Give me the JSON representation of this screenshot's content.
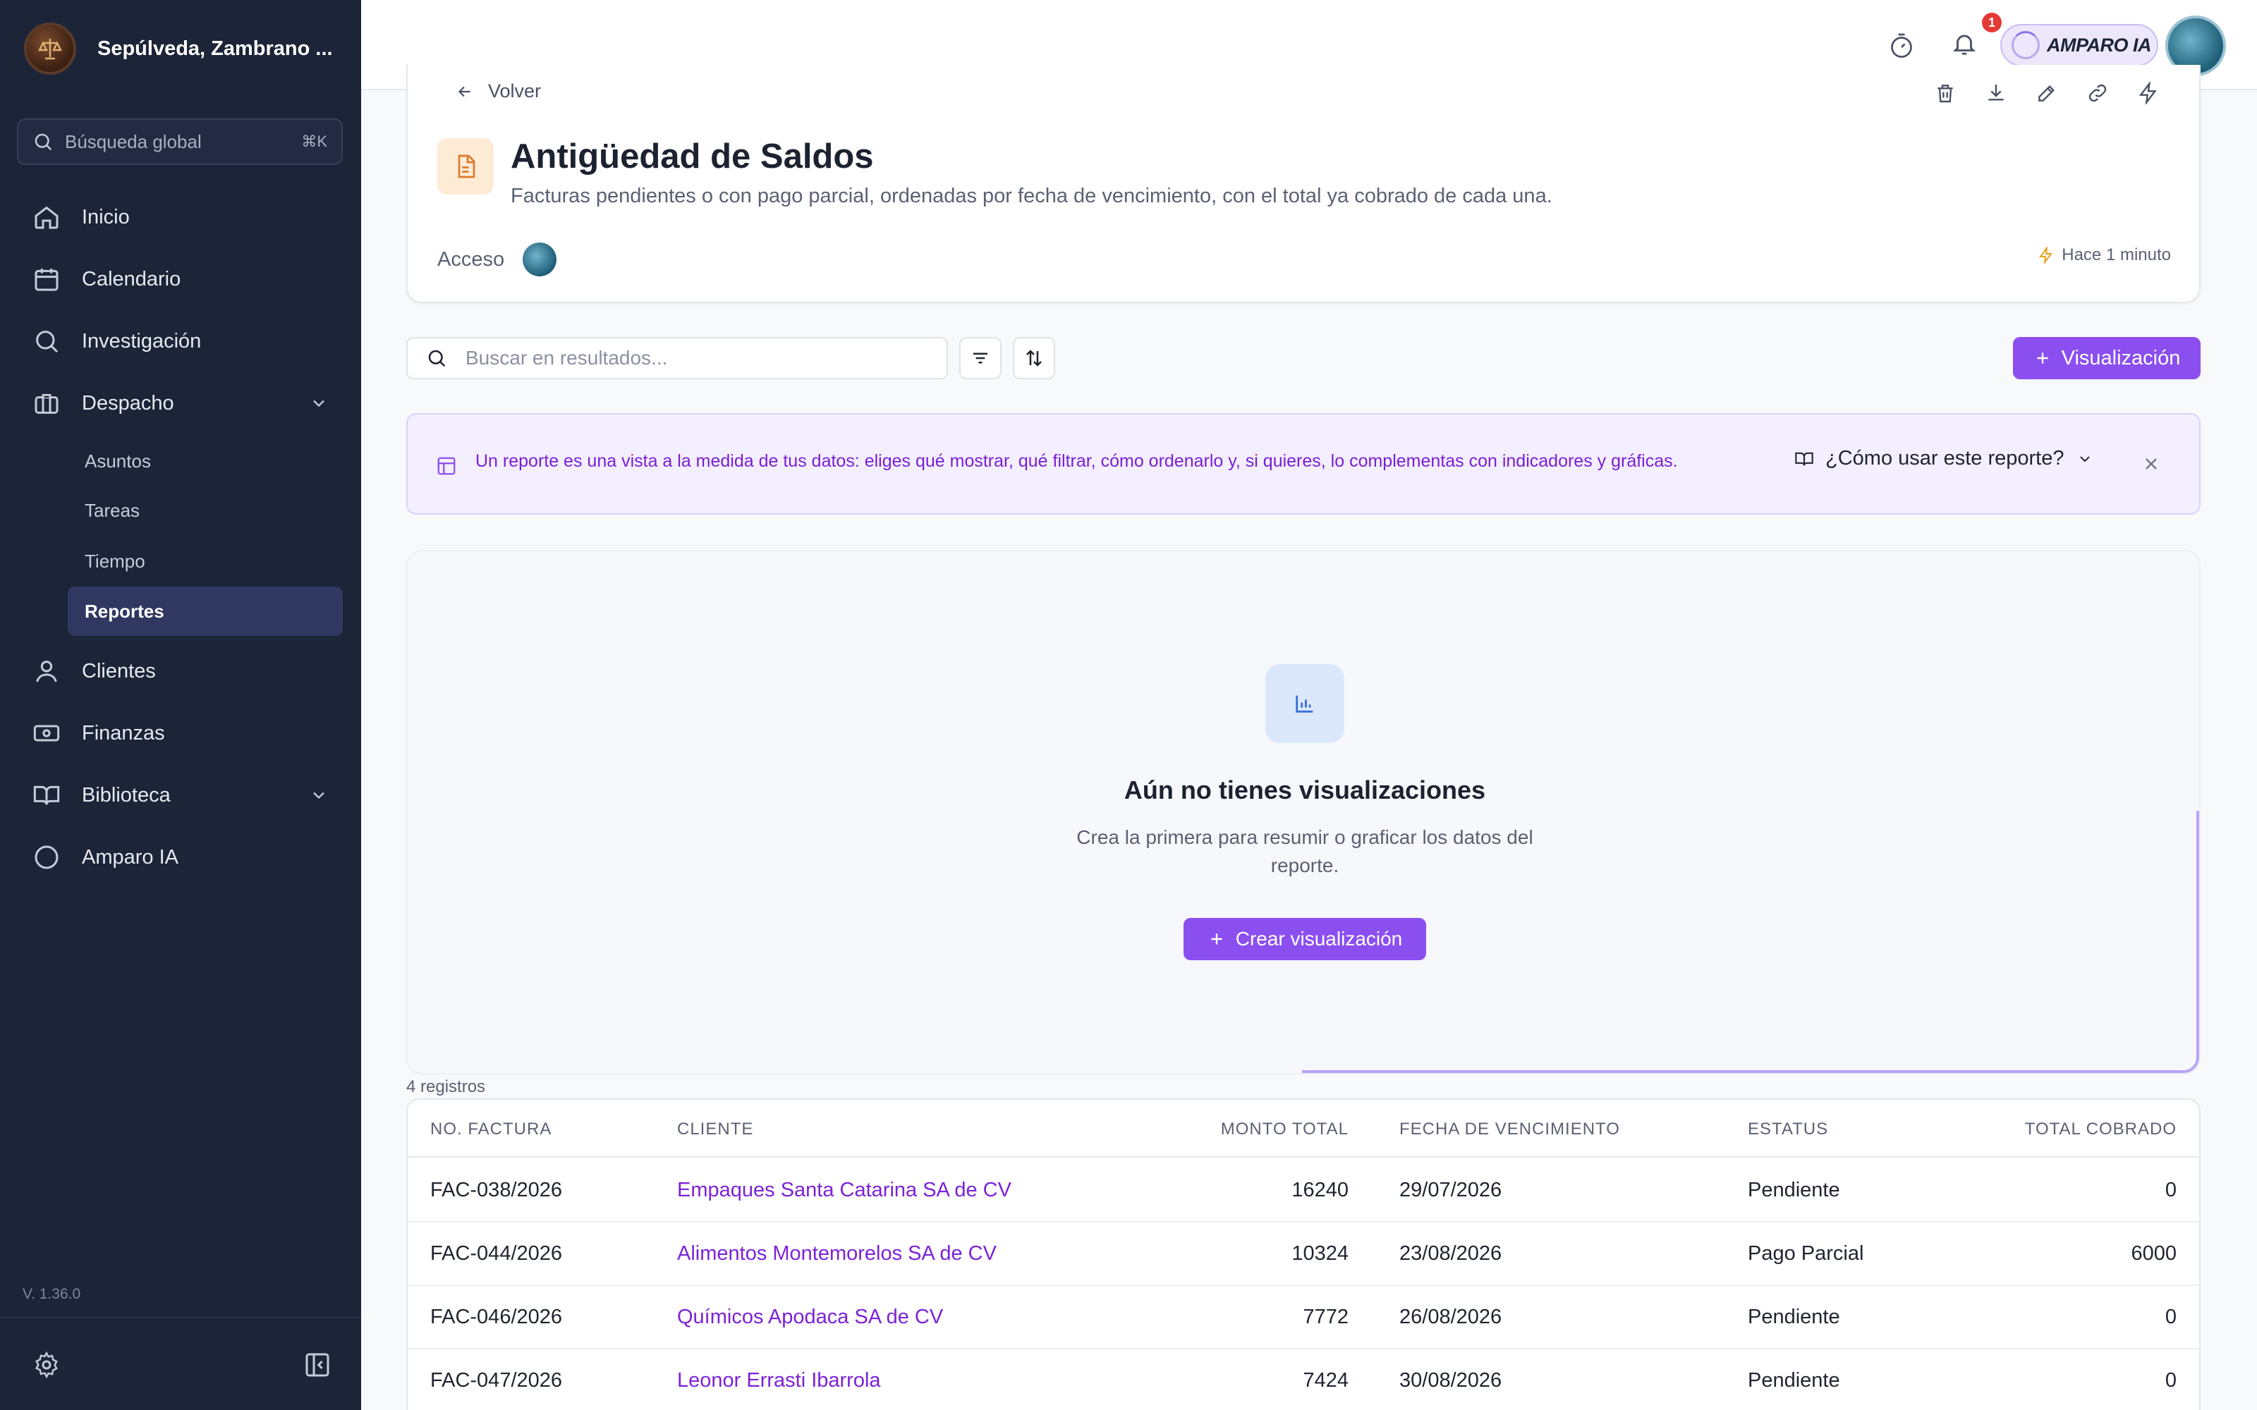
{
  "sidebar": {
    "brand": "Sepúlveda, Zambrano ...",
    "search_placeholder": "Búsqueda global",
    "search_shortcut": "⌘K",
    "nav": {
      "inicio": "Inicio",
      "calendario": "Calendario",
      "investigacion": "Investigación",
      "despacho": "Despacho",
      "clientes": "Clientes",
      "finanzas": "Finanzas",
      "biblioteca": "Biblioteca",
      "amparo": "Amparo IA"
    },
    "despacho_sub": {
      "asuntos": "Asuntos",
      "tareas": "Tareas",
      "tiempo": "Tiempo",
      "reportes": "Reportes"
    },
    "version": "V. 1.36.0"
  },
  "topbar": {
    "notifications": "1",
    "amparo_label": "AMPARO IA"
  },
  "report": {
    "back": "Volver",
    "title": "Antigüedad de Saldos",
    "description": "Facturas pendientes o con pago parcial, ordenadas por fecha de vencimiento, con el total ya cobrado de cada una.",
    "access_label": "Acceso",
    "updated": "Hace 1 minuto"
  },
  "toolbar": {
    "search_placeholder": "Buscar en resultados...",
    "viz_button": "Visualización"
  },
  "banner": {
    "text": "Un reporte es una vista a la medida de tus datos: eliges qué mostrar, qué filtrar, cómo ordenarlo y, si quieres, lo complementas con indicadores y gráficas.",
    "how_to": "¿Cómo usar este reporte?"
  },
  "empty_viz": {
    "title": "Aún no tienes visualizaciones",
    "description": "Crea la primera para resumir o graficar los datos del reporte.",
    "cta": "Crear visualización"
  },
  "table": {
    "count": "4 registros",
    "headers": {
      "factura": "NO. FACTURA",
      "cliente": "CLIENTE",
      "monto": "MONTO TOTAL",
      "vencimiento": "FECHA DE VENCIMIENTO",
      "estatus": "ESTATUS",
      "cobrado": "TOTAL COBRADO"
    },
    "rows": [
      {
        "factura": "FAC-038/2026",
        "cliente": "Empaques Santa Catarina SA de CV",
        "monto": "16240",
        "vencimiento": "29/07/2026",
        "estatus": "Pendiente",
        "cobrado": "0"
      },
      {
        "factura": "FAC-044/2026",
        "cliente": "Alimentos Montemorelos SA de CV",
        "monto": "10324",
        "vencimiento": "23/08/2026",
        "estatus": "Pago Parcial",
        "cobrado": "6000"
      },
      {
        "factura": "FAC-046/2026",
        "cliente": "Químicos Apodaca SA de CV",
        "monto": "7772",
        "vencimiento": "26/08/2026",
        "estatus": "Pendiente",
        "cobrado": "0"
      },
      {
        "factura": "FAC-047/2026",
        "cliente": "Leonor Errasti Ibarrola",
        "monto": "7424",
        "vencimiento": "30/08/2026",
        "estatus": "Pendiente",
        "cobrado": "0"
      }
    ]
  },
  "colors": {
    "sidebar_bg": "#1c2438",
    "accent": "#8b4ff0",
    "link": "#7d22d8",
    "badge": "#e53935"
  }
}
